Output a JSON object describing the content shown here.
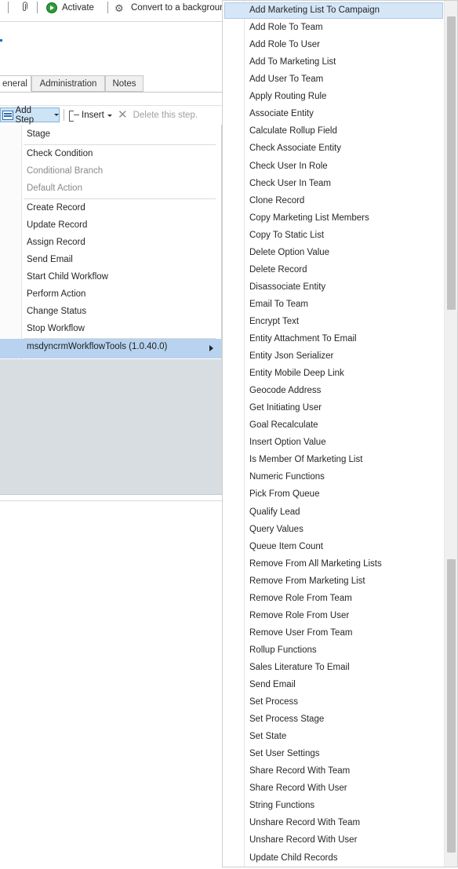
{
  "toolbar": {
    "activate_label": "Activate",
    "convert_label": "Convert to a backgroun"
  },
  "tabs": [
    {
      "label": "eneral"
    },
    {
      "label": "Administration"
    },
    {
      "label": "Notes"
    }
  ],
  "step_bar": {
    "add_step_label": "Add Step",
    "insert_label": "Insert",
    "delete_label": "Delete this step."
  },
  "step_menu": {
    "items": [
      {
        "label": "Stage"
      },
      {
        "label": "Check Condition"
      },
      {
        "label": "Conditional Branch"
      },
      {
        "label": "Default Action"
      },
      {
        "label": "Create Record"
      },
      {
        "label": "Update Record"
      },
      {
        "label": "Assign Record"
      },
      {
        "label": "Send Email"
      },
      {
        "label": "Start Child Workflow"
      },
      {
        "label": "Perform Action"
      },
      {
        "label": "Change Status"
      },
      {
        "label": "Stop Workflow"
      }
    ],
    "highlighted_item": "msdyncrmWorkflowTools (1.0.40.0)"
  },
  "submenu": {
    "items": [
      {
        "label": "Add Marketing List To Campaign"
      },
      {
        "label": "Add Role To Team"
      },
      {
        "label": "Add Role To User"
      },
      {
        "label": "Add To Marketing List"
      },
      {
        "label": "Add User To Team"
      },
      {
        "label": "Apply Routing Rule"
      },
      {
        "label": "Associate Entity"
      },
      {
        "label": "Calculate Rollup Field"
      },
      {
        "label": "Check Associate Entity"
      },
      {
        "label": "Check User In Role"
      },
      {
        "label": "Check User In Team"
      },
      {
        "label": "Clone Record"
      },
      {
        "label": "Copy Marketing List Members"
      },
      {
        "label": "Copy To Static List"
      },
      {
        "label": "Delete Option Value"
      },
      {
        "label": "Delete Record"
      },
      {
        "label": "Disassociate Entity"
      },
      {
        "label": "Email To Team"
      },
      {
        "label": "Encrypt Text"
      },
      {
        "label": "Entity Attachment To Email"
      },
      {
        "label": "Entity Json Serializer"
      },
      {
        "label": "Entity Mobile Deep Link"
      },
      {
        "label": "Geocode Address"
      },
      {
        "label": "Get Initiating User"
      },
      {
        "label": "Goal Recalculate"
      },
      {
        "label": "Insert Option Value"
      },
      {
        "label": "Is Member Of Marketing List"
      },
      {
        "label": "Numeric Functions"
      },
      {
        "label": "Pick From Queue"
      },
      {
        "label": "Qualify Lead"
      },
      {
        "label": "Query Values"
      },
      {
        "label": "Queue Item Count"
      },
      {
        "label": "Remove From All Marketing Lists"
      },
      {
        "label": "Remove From Marketing List"
      },
      {
        "label": "Remove Role From Team"
      },
      {
        "label": "Remove Role From User"
      },
      {
        "label": "Remove User From Team"
      },
      {
        "label": "Rollup Functions"
      },
      {
        "label": "Sales Literature To Email"
      },
      {
        "label": "Send Email"
      },
      {
        "label": "Set Process"
      },
      {
        "label": "Set Process Stage"
      },
      {
        "label": "Set State"
      },
      {
        "label": "Set User Settings"
      },
      {
        "label": "Share Record With Team"
      },
      {
        "label": "Share Record With User"
      },
      {
        "label": "String Functions"
      },
      {
        "label": "Unshare Record With Team"
      },
      {
        "label": "Unshare Record With User"
      },
      {
        "label": "Update Child Records"
      }
    ]
  },
  "colors": {
    "highlight": "#b7d3ef",
    "submenu_highlight": "#d5e6f7",
    "panel_grey": "#d8dde2",
    "activate_green": "#2f9a3a"
  }
}
